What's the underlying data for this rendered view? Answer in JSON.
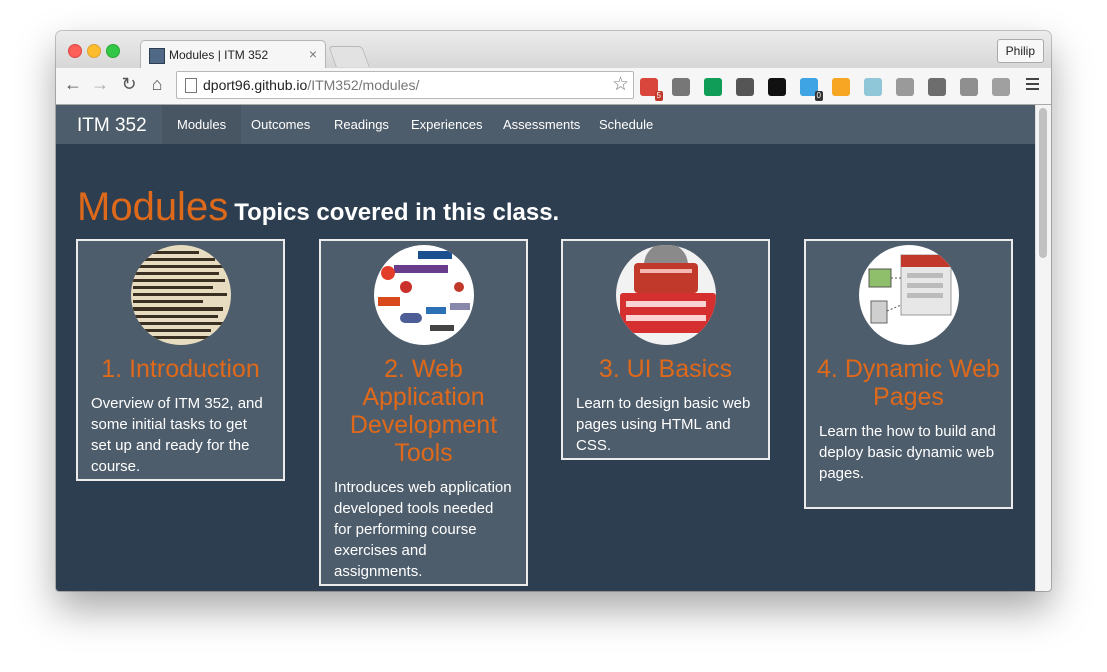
{
  "browser": {
    "tab_title": "Modules | ITM 352",
    "tab_close": "×",
    "profile_name": "Philip",
    "back_glyph": "←",
    "forward_glyph": "→",
    "reload_glyph": "↻",
    "home_glyph": "⌂",
    "url_host": "dport96.github.io",
    "url_path": "/ITM352/modules/",
    "star_glyph": "☆",
    "extensions": [
      {
        "name": "ext-1-icon",
        "color": "#d9473c",
        "badge": "5"
      },
      {
        "name": "sync-icon",
        "color": "#777777"
      },
      {
        "name": "hangouts-icon",
        "color": "#0f9d58"
      },
      {
        "name": "info-icon",
        "color": "#555555"
      },
      {
        "name": "jetbrains-icon",
        "color": "#111111"
      },
      {
        "name": "ghostery-icon",
        "color": "#3ea4e4",
        "badge": "0"
      },
      {
        "name": "analytics-icon",
        "color": "#f6a623"
      },
      {
        "name": "ext-8-icon",
        "color": "#8fc7d9"
      },
      {
        "name": "ext-9-icon",
        "color": "#9a9a9a"
      },
      {
        "name": "ext-10-icon",
        "color": "#6d6d6d"
      },
      {
        "name": "drive-icon",
        "color": "#8f8f8f"
      },
      {
        "name": "ext-12-icon",
        "color": "#a0a0a0"
      }
    ]
  },
  "site": {
    "brand": "ITM 352",
    "nav": [
      {
        "label": "Modules",
        "active": true
      },
      {
        "label": "Outcomes"
      },
      {
        "label": "Readings"
      },
      {
        "label": "Experiences"
      },
      {
        "label": "Assessments"
      },
      {
        "label": "Schedule"
      }
    ]
  },
  "page": {
    "heading": "Modules",
    "subheading": "Topics covered in this class."
  },
  "modules": [
    {
      "title": "1. Introduction",
      "description": "Overview of ITM 352, and some initial tasks to get set up and ready for the course."
    },
    {
      "title": "2. Web Application Development Tools",
      "description": "Introduces web application developed tools needed for performing course exercises and assignments."
    },
    {
      "title": "3. UI Basics",
      "description": "Learn to design basic web pages using HTML and CSS."
    },
    {
      "title": "4. Dynamic Web Pages",
      "description": "Learn the how to build and deploy basic dynamic web pages."
    }
  ],
  "colors": {
    "accent": "#df691a",
    "page_bg": "#2c3e50",
    "navbar_bg": "#4e5d6c",
    "card_bg": "#4e5d6c"
  }
}
